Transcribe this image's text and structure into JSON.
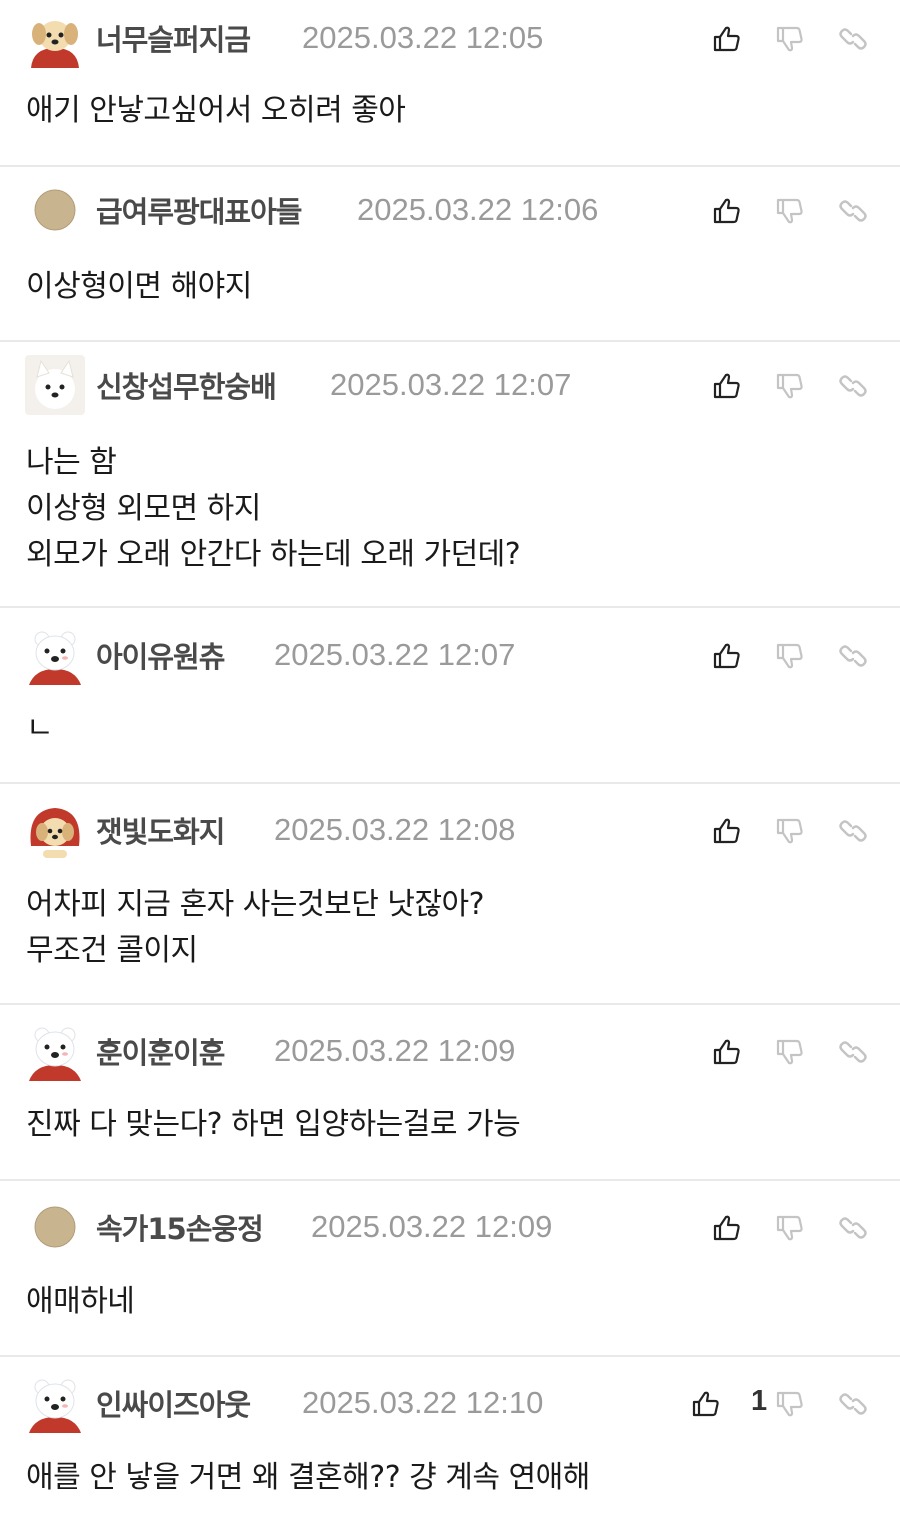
{
  "comments": [
    {
      "avatar": "puppy-red-scarf-icon",
      "nickname": "너무슬퍼지금",
      "timestamp": "2025.03.22 12:05",
      "text": "애기 안낳고싶어서 오히려 좋아",
      "like_count": ""
    },
    {
      "avatar": "default-circle-icon",
      "nickname": "급여루팡대표아들",
      "timestamp": "2025.03.22 12:06",
      "text": "이상형이면 해야지",
      "like_count": ""
    },
    {
      "avatar": "white-dog-icon",
      "nickname": "신창섭무한숭배",
      "timestamp": "2025.03.22 12:07",
      "text": "나는 함\n이상형 외모면 하지\n외모가 오래 안간다 하는데 오래 가던데?",
      "like_count": ""
    },
    {
      "avatar": "polar-bear-icon",
      "nickname": "아이유원츄",
      "timestamp": "2025.03.22 12:07",
      "text": "ㄴ",
      "like_count": ""
    },
    {
      "avatar": "puppy-red-hood-icon",
      "nickname": "잿빛도화지",
      "timestamp": "2025.03.22 12:08",
      "text": "어차피 지금 혼자 사는것보단 낫잖아?\n무조건 콜이지",
      "like_count": ""
    },
    {
      "avatar": "polar-bear-icon",
      "nickname": "훈이훈이훈",
      "timestamp": "2025.03.22 12:09",
      "text": "진짜 다 맞는다? 하면 입양하는걸로 가능",
      "like_count": ""
    },
    {
      "avatar": "default-circle-icon",
      "nickname": "속가15손웅정",
      "timestamp": "2025.03.22 12:09",
      "text": "애매하네",
      "like_count": ""
    },
    {
      "avatar": "polar-bear-icon",
      "nickname": "인싸이즈아웃",
      "timestamp": "2025.03.22 12:10",
      "text": "애를 안 낳을 거면 왜 결혼해?? 걍 계속 연애해",
      "like_count": "1"
    }
  ],
  "icons": {
    "like": "thumbs-up-icon",
    "dislike": "thumbs-down-icon",
    "link": "link-icon"
  },
  "colors": {
    "divider": "#e9e9e9",
    "nickname": "#4a4a4a",
    "timestamp": "#9a9a9a",
    "icon_active": "#222222",
    "icon_muted": "#c4c4c4"
  }
}
